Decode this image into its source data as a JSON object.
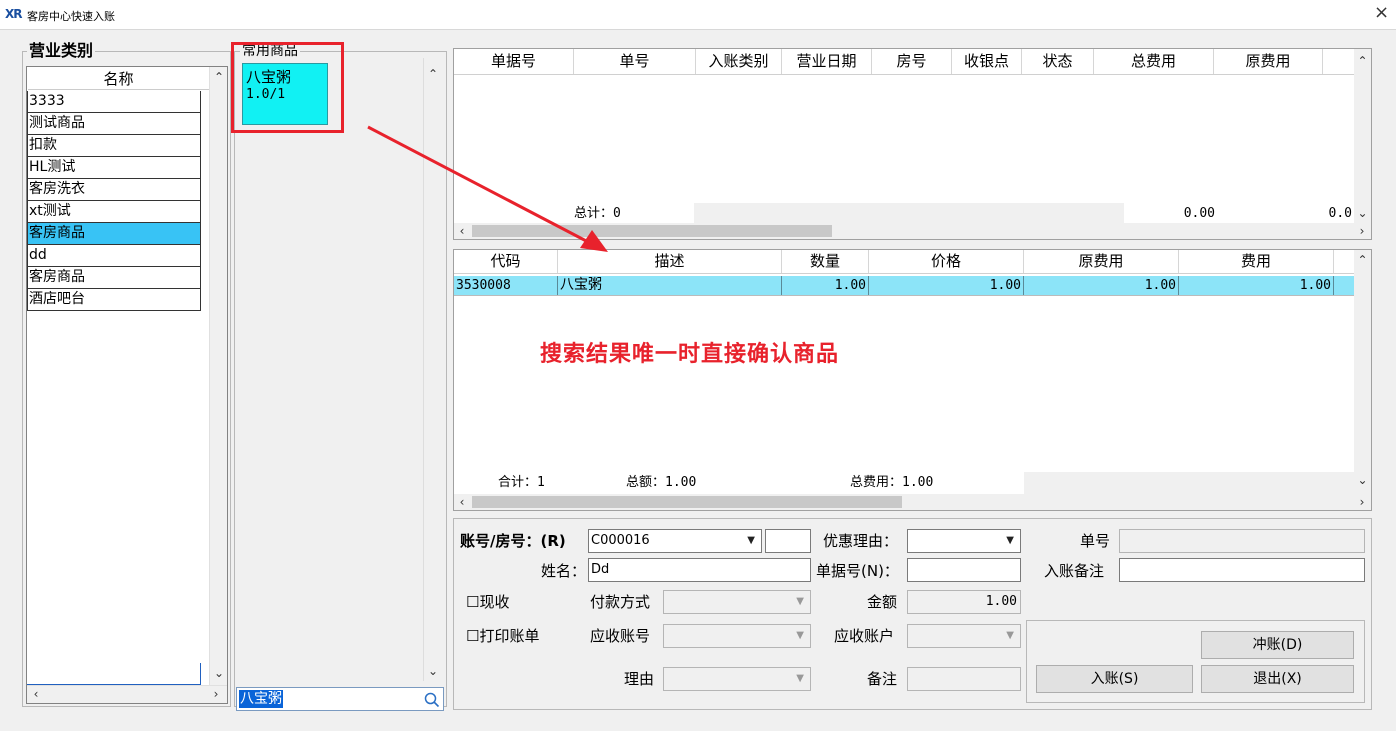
{
  "window": {
    "title": "客房中心快速入账",
    "logo": "XR",
    "close": "×"
  },
  "category": {
    "group_title": "营业类别",
    "header": "名称",
    "items": [
      "3333",
      "测试商品",
      "扣款",
      "HL测试",
      "客房洗衣",
      "xt测试",
      "客房商品",
      "dd",
      "客房商品",
      "酒店吧台"
    ],
    "selected_index": 6
  },
  "products": {
    "group_title": "常用商品",
    "tile": {
      "name": "八宝粥",
      "price": "1.0/1"
    },
    "search_value": "八宝粥"
  },
  "bills": {
    "columns": [
      "单据号",
      "单号",
      "入账类别",
      "营业日期",
      "房号",
      "收银点",
      "状态",
      "总费用",
      "原费用"
    ],
    "total_label": "总计：0",
    "total_fee": "0.00",
    "orig_fee": "0.0"
  },
  "items": {
    "columns": [
      "代码",
      "描述",
      "数量",
      "价格",
      "原费用",
      "费用"
    ],
    "rows": [
      {
        "code": "3530008",
        "desc": "八宝粥",
        "qty": "1.00",
        "price": "1.00",
        "orig": "1.00",
        "fee": "1.00"
      }
    ],
    "sum_count": "合计：1",
    "sum_amount": "总额：1.00",
    "sum_fee": "总费用：1.00"
  },
  "annotation": "搜索结果唯一时直接确认商品",
  "form": {
    "account_label": "账号/房号：(R)",
    "account_value": "C000016",
    "name_label": "姓名：",
    "name_value": "Dd",
    "discount_label": "优惠理由：",
    "voucher_label": "单据号(N)：",
    "order_label": "单号",
    "remark_label": "入账备注",
    "cash_label": "现收",
    "print_label": "打印账单",
    "payment_label": "付款方式",
    "ar_account_label": "应收账号",
    "ar_user_label": "应收账户",
    "amount_label": "金额",
    "amount_value": "1.00",
    "reason_label": "理由",
    "note_label": "备注"
  },
  "buttons": {
    "reverse": "冲账(D)",
    "post": "入账(S)",
    "exit": "退出(X)"
  },
  "colors": {
    "selection": "#38c3f5",
    "row_highlight": "#8ce4f8",
    "tile": "#11f1f3",
    "accent_red": "#e8222c"
  }
}
